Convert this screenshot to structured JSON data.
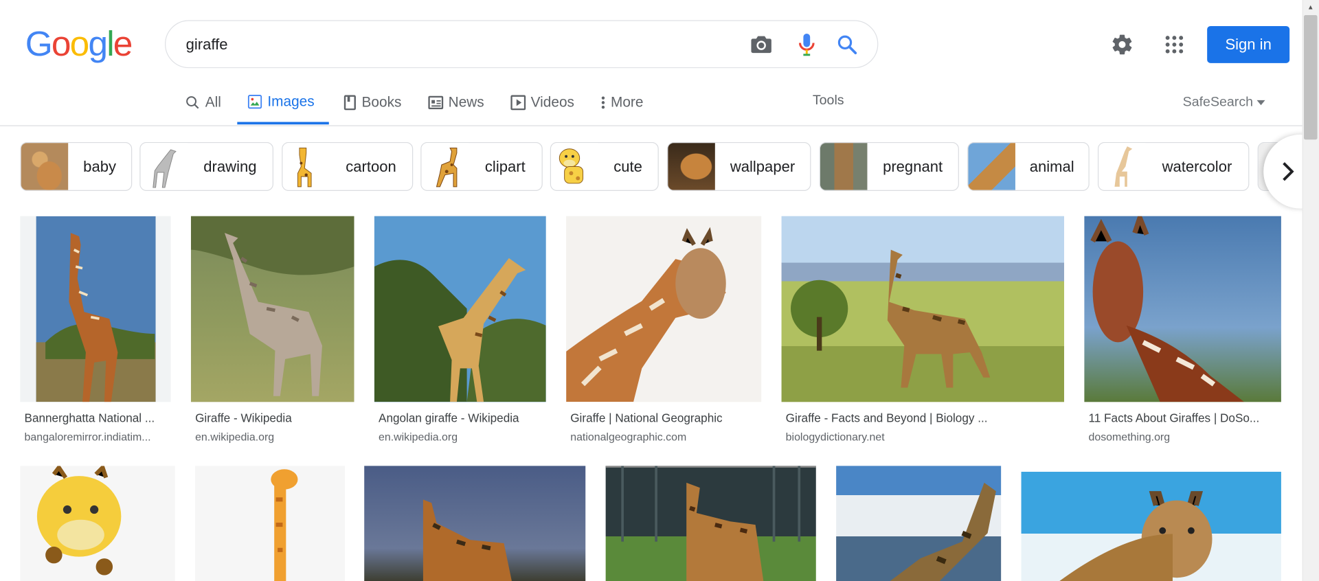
{
  "header": {
    "logo_letters": [
      "G",
      "o",
      "o",
      "g",
      "l",
      "e"
    ],
    "logo_colors": [
      "#4285f4",
      "#ea4335",
      "#fbbc05",
      "#4285f4",
      "#34a853",
      "#ea4335"
    ],
    "search_value": "giraffe",
    "camera_icon": "camera-icon",
    "mic_icon": "mic-icon",
    "search_icon": "search-icon",
    "settings_icon": "gear-icon",
    "apps_icon": "apps-grid-icon",
    "sign_in_label": "Sign in"
  },
  "tabs": [
    {
      "label": "All",
      "icon": "search-icon",
      "active": false
    },
    {
      "label": "Images",
      "icon": "image-icon",
      "active": true
    },
    {
      "label": "Books",
      "icon": "book-icon",
      "active": false
    },
    {
      "label": "News",
      "icon": "news-icon",
      "active": false
    },
    {
      "label": "Videos",
      "icon": "play-icon",
      "active": false
    },
    {
      "label": "More",
      "icon": "more-vert-icon",
      "active": false
    }
  ],
  "tools_label": "Tools",
  "safesearch_label": "SafeSearch",
  "chips": [
    {
      "label": "baby"
    },
    {
      "label": "drawing"
    },
    {
      "label": "cartoon"
    },
    {
      "label": "clipart"
    },
    {
      "label": "cute"
    },
    {
      "label": "wallpaper"
    },
    {
      "label": "pregnant"
    },
    {
      "label": "animal"
    },
    {
      "label": "watercolor"
    }
  ],
  "results_row1": [
    {
      "title": "Bannerghatta National ...",
      "source": "bangaloremirror.indiatim..."
    },
    {
      "title": "Giraffe - Wikipedia",
      "source": "en.wikipedia.org"
    },
    {
      "title": "Angolan giraffe - Wikipedia",
      "source": "en.wikipedia.org"
    },
    {
      "title": "Giraffe | National Geographic",
      "source": "nationalgeographic.com"
    },
    {
      "title": "Giraffe - Facts and Beyond | Biology ...",
      "source": "biologydictionary.net"
    },
    {
      "title": "11 Facts About Giraffes | DoSo...",
      "source": "dosomething.org"
    }
  ],
  "colors": {
    "accent": "#1a73e8",
    "giraffe_tan": "#d9a25a",
    "giraffe_brown": "#8b4a1e",
    "sky": "#6fa5d8",
    "grass": "#9cae4e"
  }
}
